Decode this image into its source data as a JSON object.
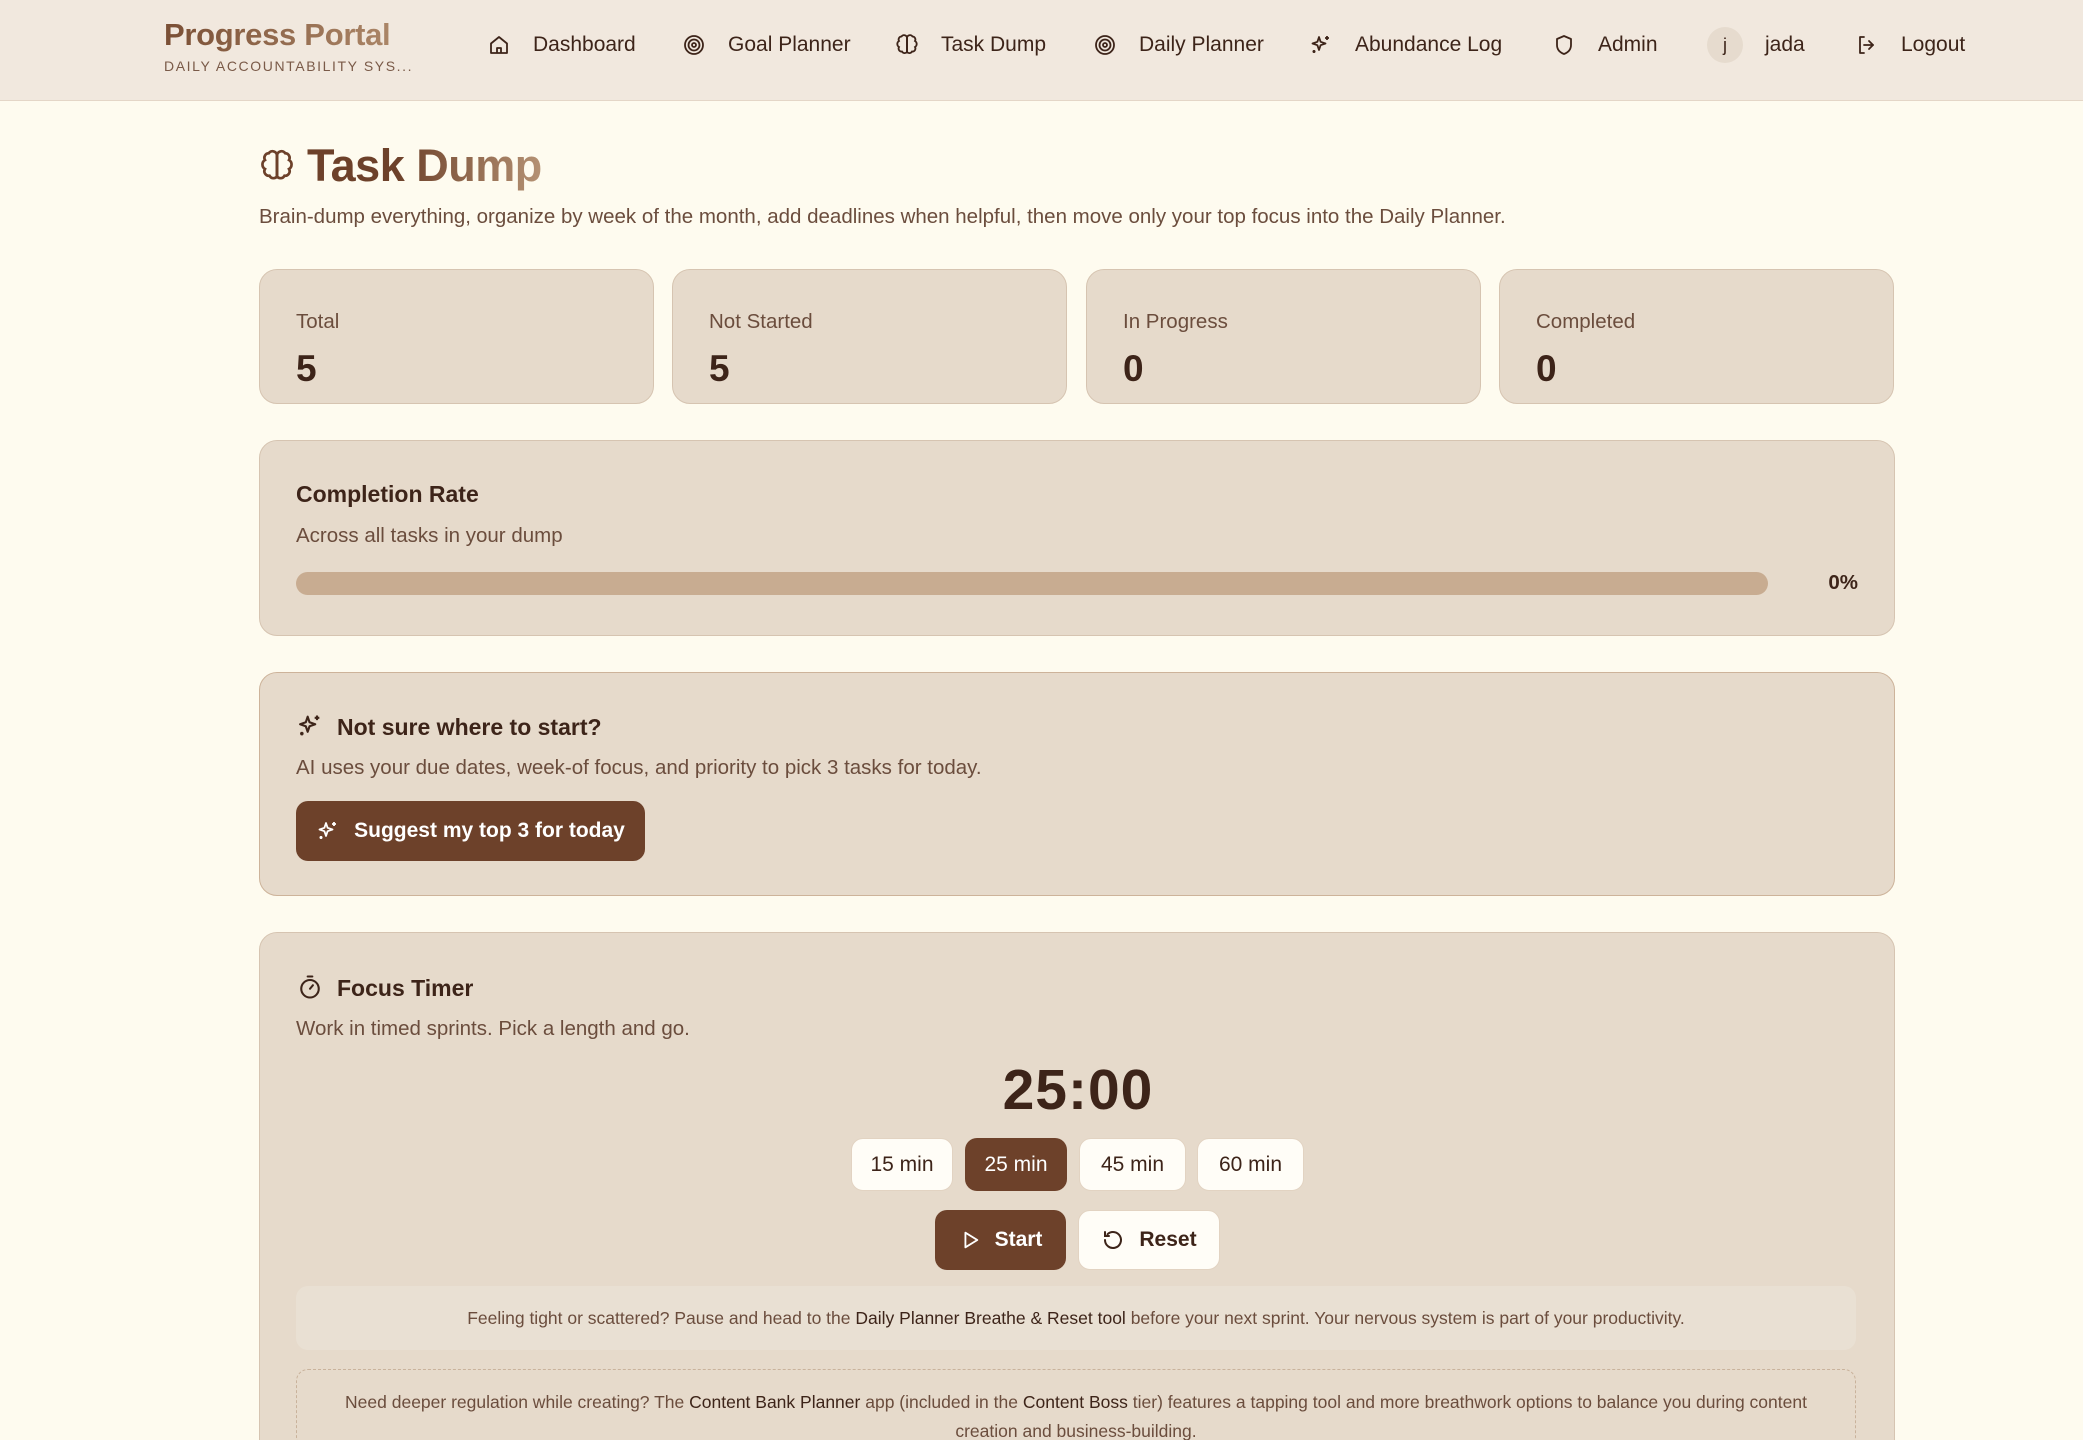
{
  "brand": {
    "title": "Progress Portal",
    "subtitle": "DAILY ACCOUNTABILITY SYS..."
  },
  "nav": {
    "items": [
      {
        "label": "Dashboard",
        "icon": "home-icon"
      },
      {
        "label": "Goal Planner",
        "icon": "target-icon"
      },
      {
        "label": "Task Dump",
        "icon": "brain-icon"
      },
      {
        "label": "Daily Planner",
        "icon": "target-icon"
      },
      {
        "label": "Abundance Log",
        "icon": "sparkles-icon"
      },
      {
        "label": "Admin",
        "icon": "shield-icon"
      }
    ],
    "user": {
      "initial": "j",
      "name": "jada"
    },
    "logout": {
      "label": "Logout",
      "icon": "logout-icon"
    }
  },
  "page": {
    "title": "Task Dump",
    "icon": "brain-icon",
    "description": "Brain-dump everything, organize by week of the month, add deadlines when helpful, then move only your top focus into the Daily Planner."
  },
  "stats": [
    {
      "label": "Total",
      "value": "5"
    },
    {
      "label": "Not Started",
      "value": "5"
    },
    {
      "label": "In Progress",
      "value": "0"
    },
    {
      "label": "Completed",
      "value": "0"
    }
  ],
  "completion": {
    "title": "Completion Rate",
    "subtitle": "Across all tasks in your dump",
    "percent_label": "0%",
    "progress": 0
  },
  "suggest": {
    "title": "Not sure where to start?",
    "description": "AI uses your due dates, week-of focus, and priority to pick 3 tasks for today.",
    "button_label": "Suggest my top 3 for today"
  },
  "timer": {
    "title": "Focus Timer",
    "subtitle": "Work in timed sprints. Pick a length and go.",
    "display": "25:00",
    "durations": [
      "15 min",
      "25 min",
      "45 min",
      "60 min"
    ],
    "selected_duration": "25 min",
    "start_label": "Start",
    "reset_label": "Reset",
    "note": {
      "pre": "Feeling tight or scattered? Pause and head to the",
      "link": "Daily Planner Breathe & Reset tool",
      "post": "before your next sprint. Your nervous system is part of your productivity."
    },
    "deeper": {
      "pre": "Need deeper regulation while creating? The",
      "app": "Content Bank Planner",
      "mid": "app (included in the",
      "tier": "Content Boss",
      "post": "tier) features a tapping tool and more breathwork options to balance you during content creation and business-building."
    }
  },
  "colors": {
    "accent": "#6d412a",
    "background": "#fefbef",
    "card": "#e6dacb",
    "header": "#f1e8de"
  }
}
